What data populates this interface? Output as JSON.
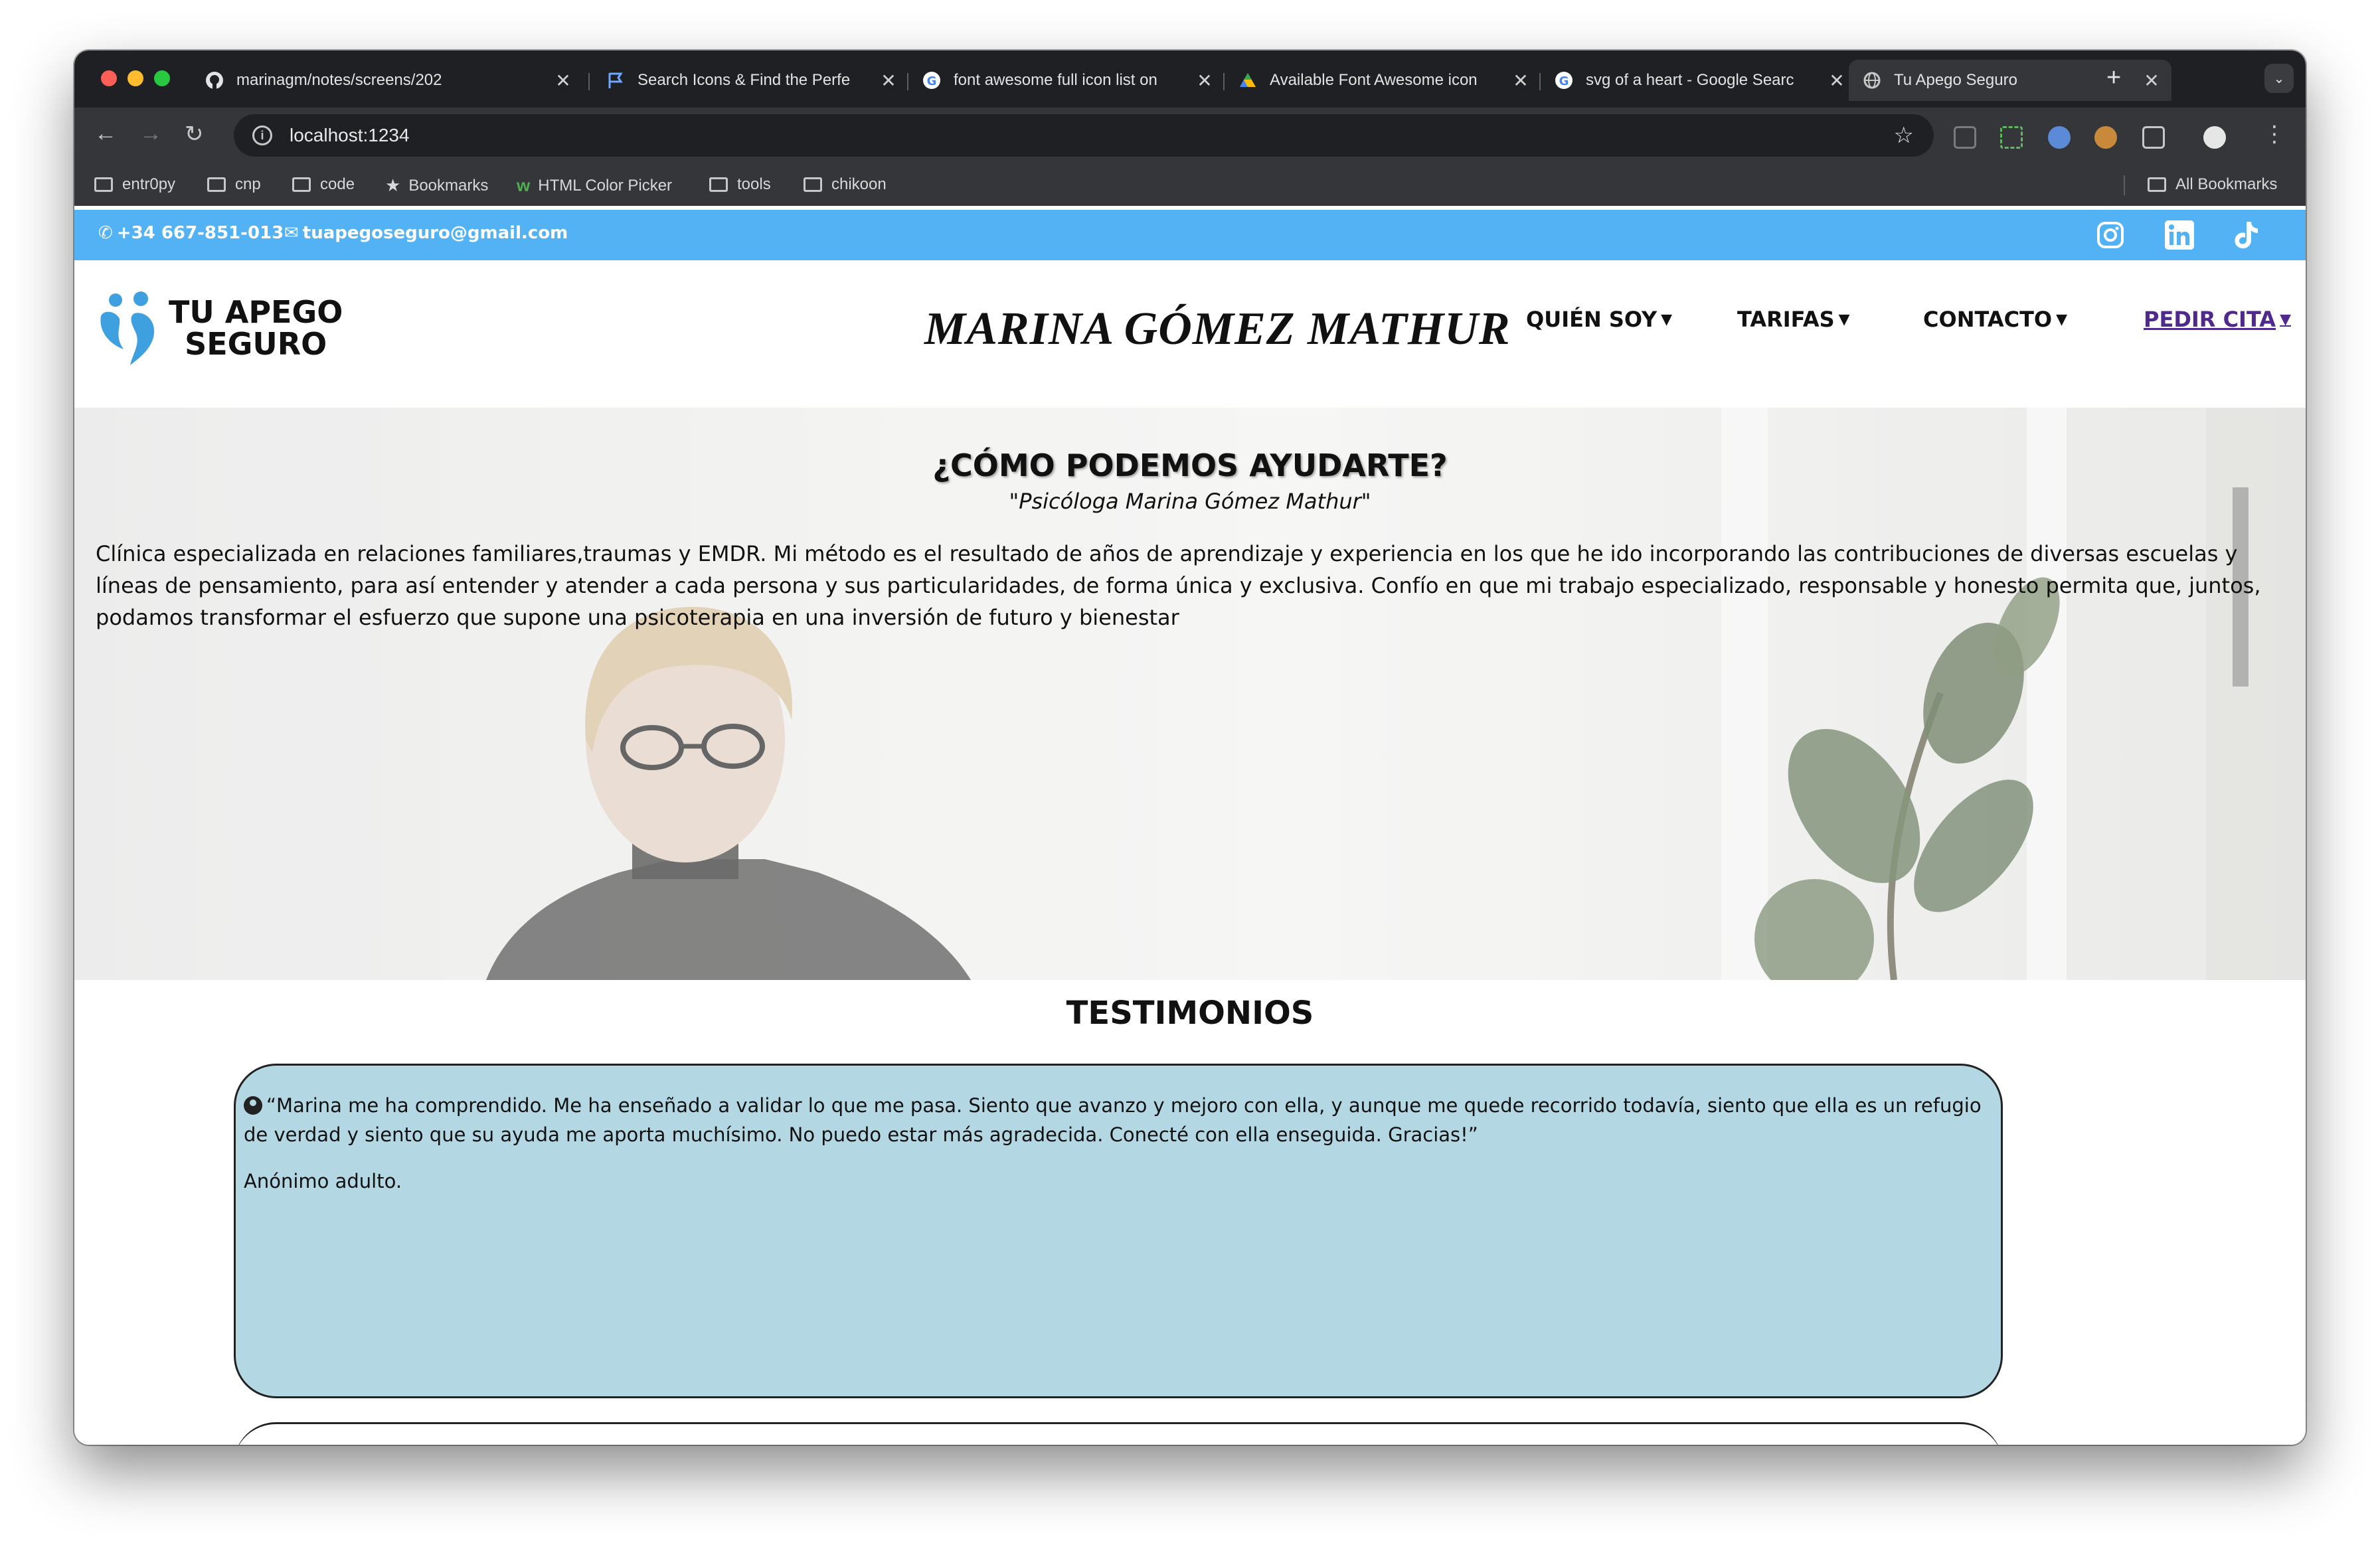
{
  "browser": {
    "tabs": [
      {
        "title": "marinagm/notes/screens/202",
        "favicon": "github-icon"
      },
      {
        "title": "Search Icons & Find the Perfe",
        "favicon": "flag-icon"
      },
      {
        "title": "font awesome full icon list on",
        "favicon": "google-icon"
      },
      {
        "title": "Available Font Awesome icon",
        "favicon": "drive-icon"
      },
      {
        "title": "svg of a heart - Google Searc",
        "favicon": "google-icon"
      },
      {
        "title": "Tu Apego Seguro",
        "favicon": "globe-icon",
        "active": true
      }
    ],
    "new_tab": "+",
    "url": "localhost:1234",
    "bookmarks": [
      {
        "label": "entr0py",
        "icon": "folder-icon"
      },
      {
        "label": "cnp",
        "icon": "folder-icon"
      },
      {
        "label": "code",
        "icon": "folder-icon"
      },
      {
        "label": "Bookmarks",
        "icon": "star-icon"
      },
      {
        "label": "HTML Color Picker",
        "icon": "w3-icon"
      },
      {
        "label": "tools",
        "icon": "folder-icon"
      },
      {
        "label": "chikoon",
        "icon": "folder-icon"
      }
    ],
    "all_bookmarks": "All Bookmarks"
  },
  "topbar": {
    "phone": "+34 667-851-013",
    "email": "tuapegoseguro@gmail.com",
    "social": [
      "instagram-icon",
      "linkedin-icon",
      "tiktok-icon"
    ],
    "color": "#52b2f3"
  },
  "header": {
    "logo_line1": "TU APEGO",
    "logo_line2": "SEGURO",
    "brand": "MARINA GÓMEZ MATHUR",
    "menu": [
      {
        "label": "QUIÉN SOY"
      },
      {
        "label": "TARIFAS"
      },
      {
        "label": "CONTACTO"
      },
      {
        "label": "PEDIR CITA"
      }
    ]
  },
  "hero": {
    "title": "¿CÓMO PODEMOS AYUDARTE?",
    "subtitle": "\"Psicóloga Marina Gómez Mathur\"",
    "text": "Clínica especializada en relaciones familiares,traumas y EMDR. Mi método es el resultado de años de aprendizaje y experiencia en los que he ido incorporando las contribuciones de diversas escuelas y líneas de pensamiento, para así entender y atender a cada persona y sus particularidades, de forma única y exclusiva. Confío en que mi trabajo especializado, responsable y honesto permita que, juntos, podamos transformar el esfuerzo que supone una psicoterapia en una inversión de futuro y bienestar"
  },
  "testimonials": {
    "title": "TESTIMONIOS",
    "items": [
      {
        "quote": "“Marina me ha comprendido. Me ha enseñado a validar lo que me pasa. Siento que avanzo y mejoro con ella, y aunque me quede recorrido todavía, siento que ella es un refugio de verdad y siento que su ayuda me aporta muchísimo. No puedo estar más agradecida. Conecté con ella enseguida. Gracias!”",
        "author": "Anónimo adulto.",
        "color": "#b3d8e4"
      }
    ]
  }
}
